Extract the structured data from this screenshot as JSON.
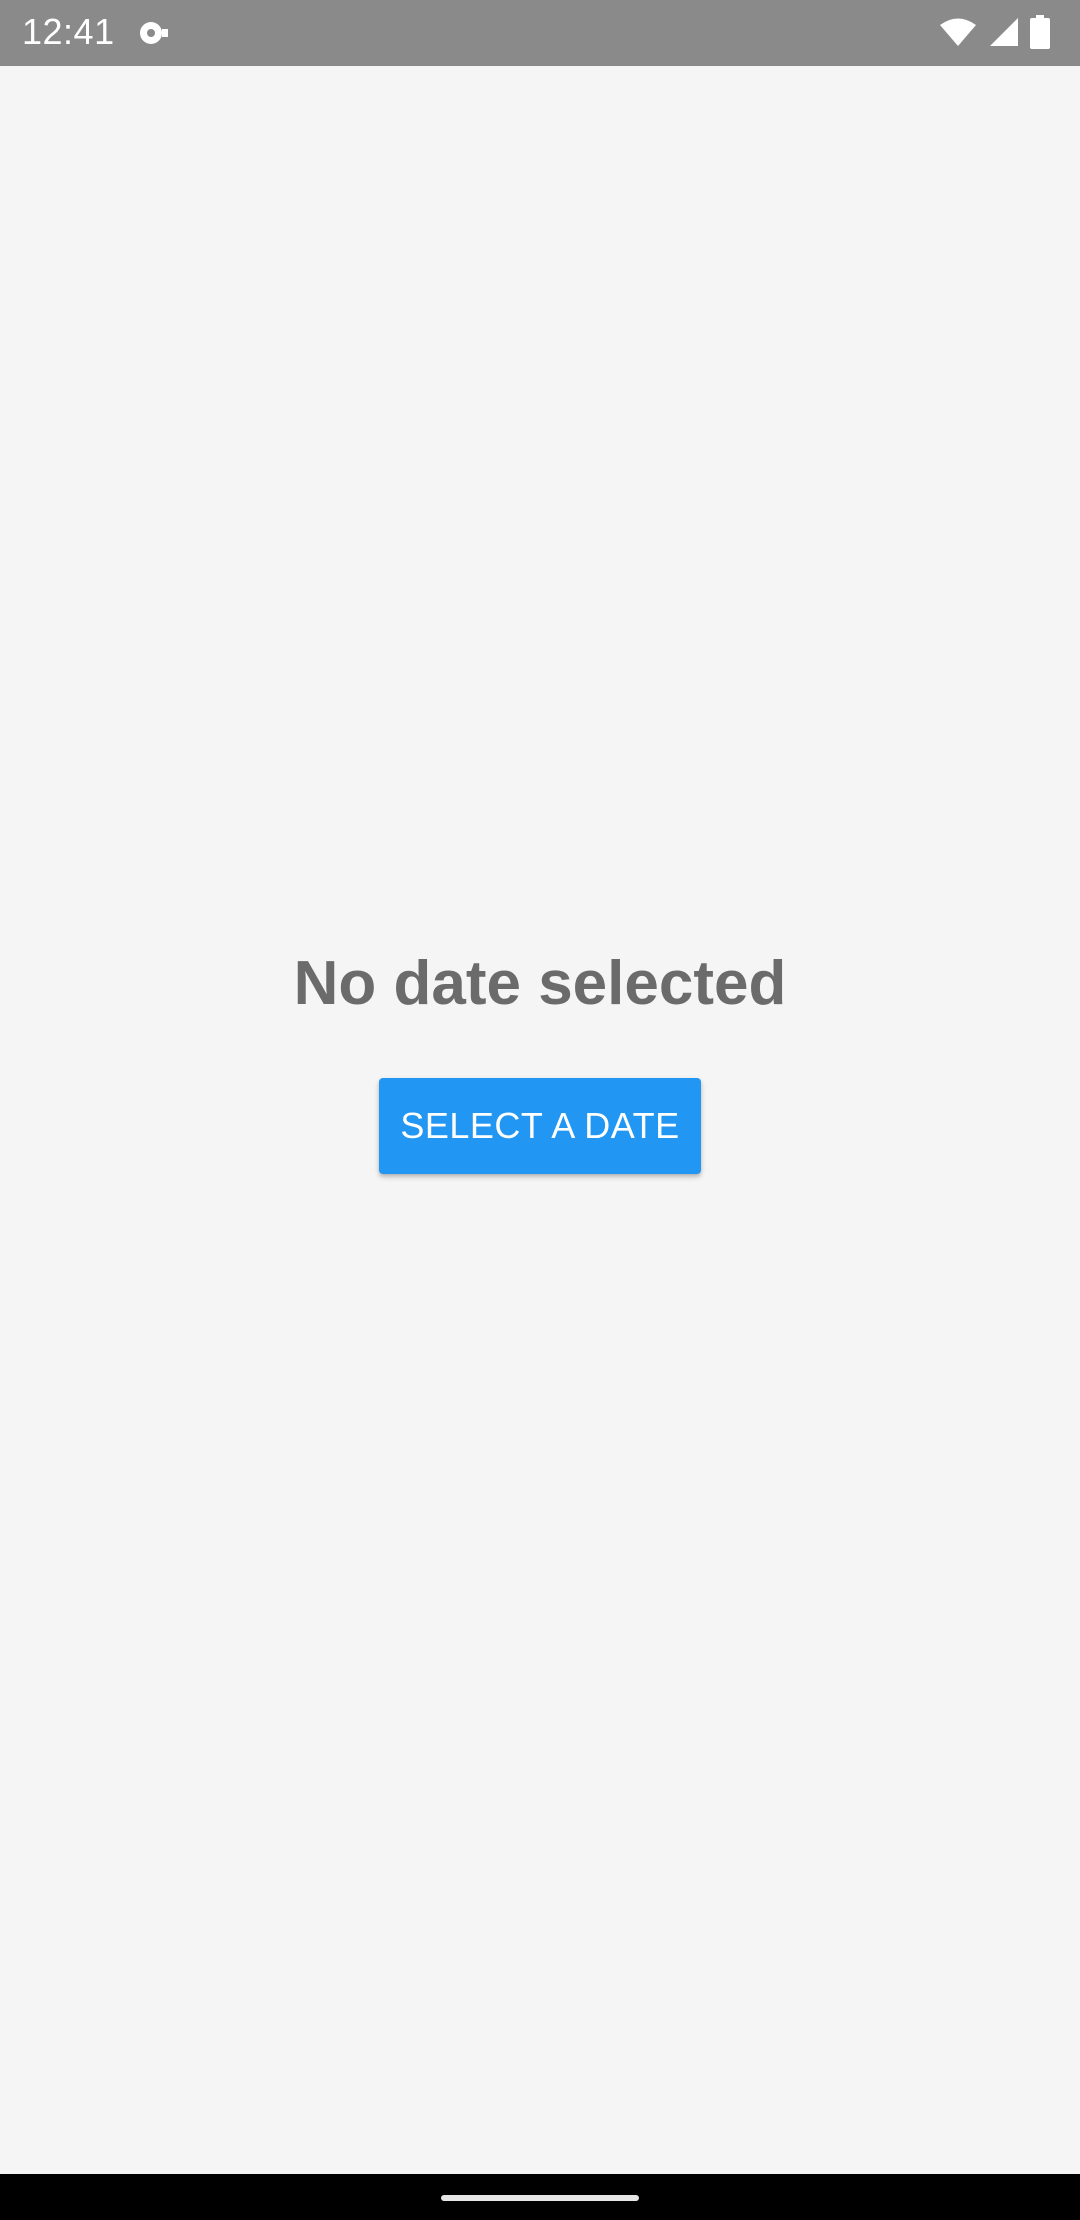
{
  "status_bar": {
    "time": "12:41",
    "icons": [
      "notification-icon",
      "wifi-icon",
      "cellular-signal-icon",
      "battery-icon"
    ]
  },
  "main": {
    "message": "No date selected",
    "select_button_label": "SELECT A DATE"
  },
  "colors": {
    "status_bar_bg": "#8a8a8a",
    "background": "#f5f5f5",
    "message_text": "#6b6b6b",
    "button_bg": "#2196f3",
    "button_text": "#ffffff",
    "nav_bar_bg": "#000000"
  }
}
